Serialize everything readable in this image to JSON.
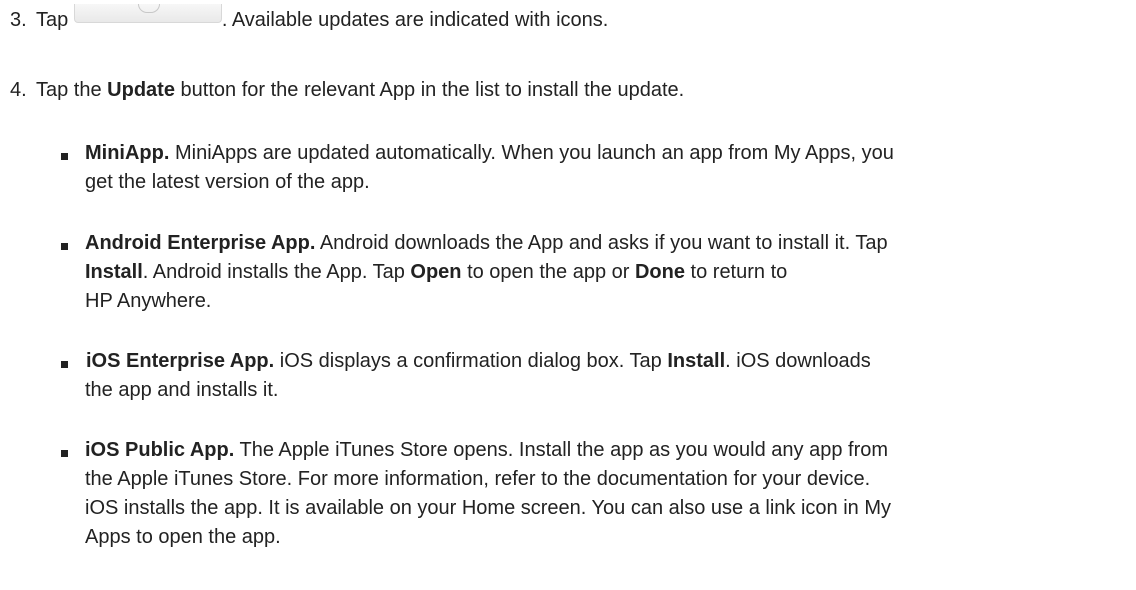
{
  "step3": {
    "number": "3.",
    "prefix": "Tap",
    "icon": "refresh-button-icon",
    "suffix": ". Available updates are indicated with icons."
  },
  "step4": {
    "number": "4.",
    "t1": "Tap the ",
    "b1": "Update",
    "t2": " button for the relevant App in the list to install the update."
  },
  "bullets": {
    "miniapp": {
      "title": "MiniApp.",
      "l1": " MiniApps are updated automatically. When you launch an app from My Apps, you",
      "l2": "get the latest version of the app."
    },
    "android": {
      "title": "Android Enterprise App.",
      "l1": " Android downloads the App and asks if you want to install it. Tap",
      "l2_b1": "Install",
      "l2_t1": ". Android installs the App. Tap ",
      "l2_b2": "Open",
      "l2_t2": " to open the app or ",
      "l2_b3": "Done",
      "l2_t3": " to return to",
      "l3": "HP Anywhere."
    },
    "ios_enterprise": {
      "title": "iOS Enterprise App.",
      "l1_t1": " iOS displays a confirmation dialog box. Tap ",
      "l1_b1": "Install",
      "l1_t2": ". iOS downloads",
      "l2": "the app and installs it."
    },
    "ios_public": {
      "title": "iOS Public App.",
      "l1": " The Apple iTunes Store opens. Install the app as you would any app from",
      "l2": "the Apple iTunes Store. For more information, refer to the documentation for your device.",
      "l3": "iOS installs the app. It is available on your Home screen. You can also use a link icon in My",
      "l4": "Apps to open the app."
    }
  }
}
